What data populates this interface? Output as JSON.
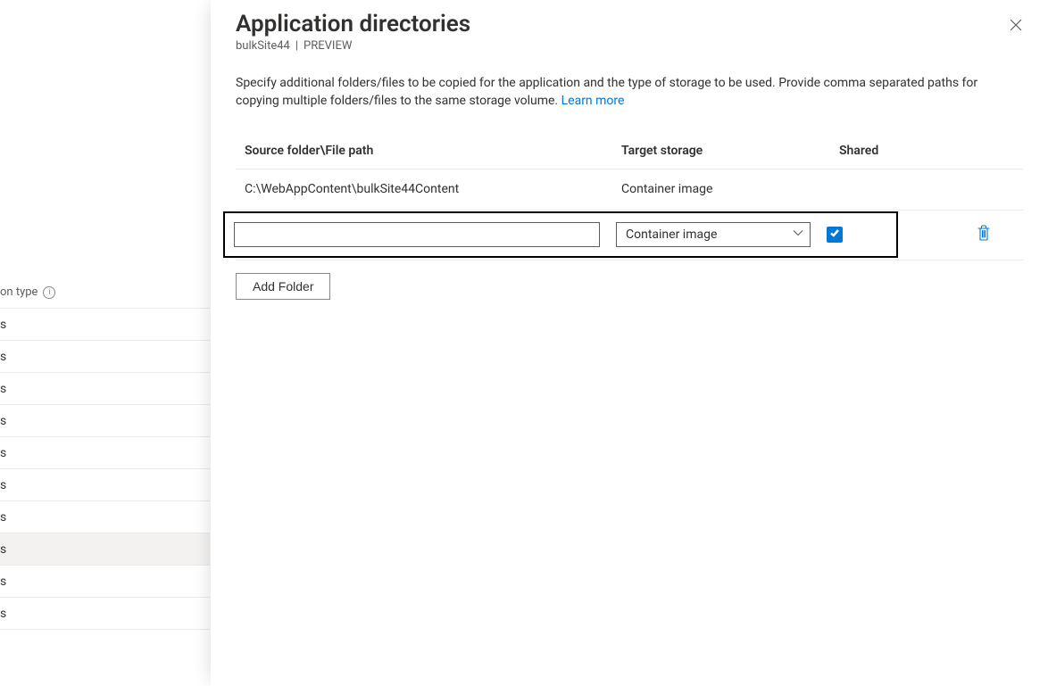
{
  "background": {
    "header_label": "on type",
    "rows": [
      {
        "label": "s",
        "selected": false
      },
      {
        "label": "s",
        "selected": false
      },
      {
        "label": "s",
        "selected": false
      },
      {
        "label": "s",
        "selected": false
      },
      {
        "label": "s",
        "selected": false
      },
      {
        "label": "s",
        "selected": false
      },
      {
        "label": "s",
        "selected": false
      },
      {
        "label": "s",
        "selected": true
      },
      {
        "label": "s",
        "selected": false
      },
      {
        "label": "s",
        "selected": false
      }
    ]
  },
  "panel": {
    "title": "Application directories",
    "context_name": "bulkSite44",
    "context_divider": "|",
    "preview_badge": "PREVIEW",
    "description_text": "Specify additional folders/files to be copied for the application and the type of storage to be used. Provide comma separated paths for copying multiple folders/files to the same storage volume. ",
    "learn_more_label": "Learn more",
    "columns": {
      "source": "Source folder\\File path",
      "target": "Target storage",
      "shared": "Shared"
    },
    "rows": [
      {
        "source": "C:\\WebAppContent\\bulkSite44Content",
        "target": "Container image",
        "shared": null
      }
    ],
    "edit_row": {
      "source_value": "",
      "target_selected": "Container image",
      "target_options": [
        "Container image"
      ],
      "shared_checked": true
    },
    "add_folder_label": "Add Folder"
  },
  "icons": {
    "close": "close-icon",
    "chevron_down": "chevron-down-icon",
    "checkmark": "checkmark-icon",
    "trash": "trash-icon",
    "info": "info-icon"
  }
}
